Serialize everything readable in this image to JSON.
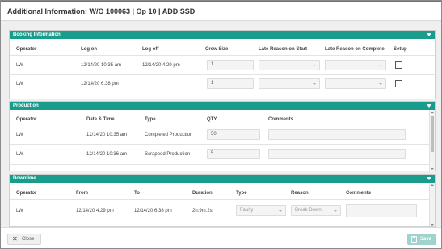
{
  "dialog": {
    "title": "Additional Information: W/O 100063 | Op 10 | ADD SSD"
  },
  "booking": {
    "header": "Booking Information",
    "columns": [
      "Operator",
      "Log on",
      "Log off",
      "Crew Size",
      "Late Reason on Start",
      "Late Reason on Complete",
      "Setup"
    ],
    "rows": [
      {
        "operator": "LW",
        "log_on": "12/14/20 10:35 am",
        "log_off": "12/14/20 4:29 pm",
        "crew_size": "1",
        "late_start": "",
        "late_complete": "",
        "setup": false
      },
      {
        "operator": "LW",
        "log_on": "12/14/20 6:38 pm",
        "log_off": "",
        "crew_size": "1",
        "late_start": "",
        "late_complete": "",
        "setup": false
      }
    ]
  },
  "production": {
    "header": "Production",
    "columns": [
      "Operator",
      "Date & Time",
      "Type",
      "QTY",
      "Comments"
    ],
    "rows": [
      {
        "operator": "LW",
        "datetime": "12/14/20 10:35 am",
        "type": "Completed Production",
        "qty": "50",
        "comments": ""
      },
      {
        "operator": "LW",
        "datetime": "12/14/20 10:36 am",
        "type": "Scrapped Production",
        "qty": "5",
        "comments": ""
      }
    ]
  },
  "downtime": {
    "header": "Downtime",
    "columns": [
      "Operator",
      "From",
      "To",
      "Duration",
      "Type",
      "Reason",
      "Comments"
    ],
    "rows": [
      {
        "operator": "LW",
        "from": "12/14/20 4:29 pm",
        "to": "12/14/20 6:38 pm",
        "duration": "2h:9m:2s",
        "type": "Faulty",
        "reason": "Break Down",
        "comments": ""
      }
    ]
  },
  "footer": {
    "close_label": "Close",
    "save_label": "Save"
  },
  "colors": {
    "accent": "#1a9c8c",
    "save_disabled": "#9fd3cb"
  }
}
